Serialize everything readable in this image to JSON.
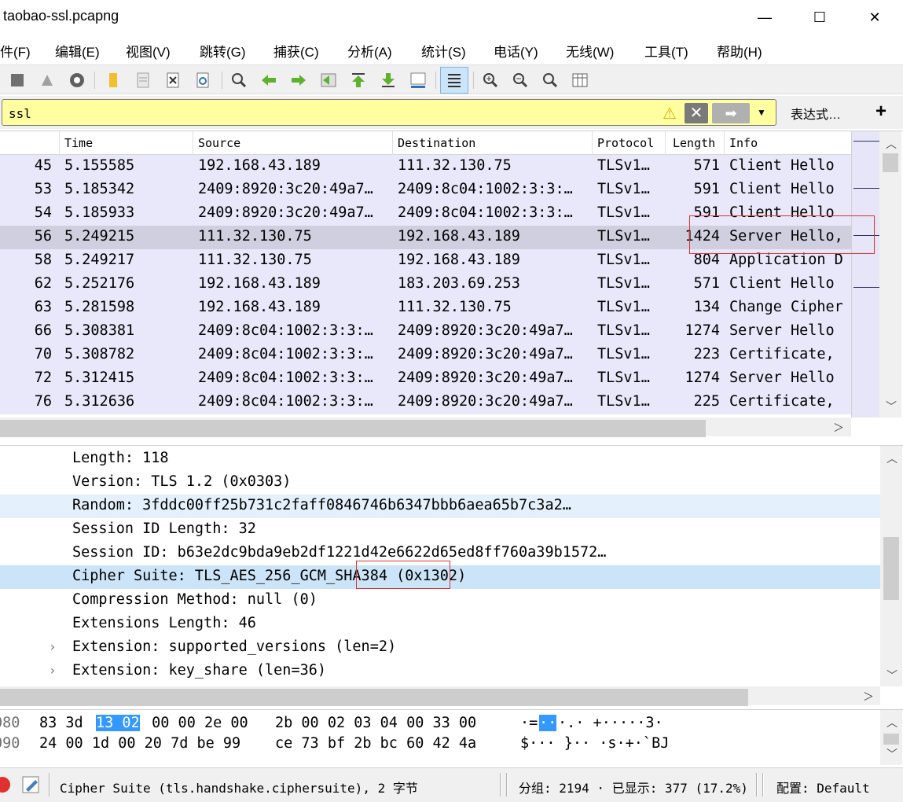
{
  "window": {
    "title": "taobao-ssl.pcapng",
    "minimize": "—",
    "maximize": "☐",
    "close": "✕"
  },
  "menu": [
    "件(F)",
    "编辑(E)",
    "视图(V)",
    "跳转(G)",
    "捕获(C)",
    "分析(A)",
    "统计(S)",
    "电话(Y)",
    "无线(W)",
    "工具(T)",
    "帮助(H)"
  ],
  "toolbar": {
    "icons": [
      "stop-capture-icon",
      "restart-capture-icon",
      "capture-options-icon",
      "open-file-icon",
      "save-file-icon",
      "close-file-icon",
      "reload-file-icon",
      "find-packet-icon",
      "go-back-icon",
      "go-forward-icon",
      "go-to-packet-icon",
      "go-first-icon",
      "go-last-icon",
      "autoscroll-icon",
      "colorize-icon",
      "zoom-in-icon",
      "zoom-out-icon",
      "zoom-normal-icon",
      "resize-columns-icon"
    ]
  },
  "filter": {
    "value": "ssl",
    "expression_label": "表达式…",
    "add_label": "+",
    "bg_color": "#ffffa0"
  },
  "packet_list": {
    "columns": [
      "Time",
      "Source",
      "Destination",
      "Protocol",
      "Length",
      "Info"
    ],
    "rows": [
      {
        "no": "45",
        "time": "5.155585",
        "src": "192.168.43.189",
        "dst": "111.32.130.75",
        "proto": "TLSv1…",
        "len": "571",
        "info": "Client Hello"
      },
      {
        "no": "53",
        "time": "5.185342",
        "src": "2409:8920:3c20:49a7…",
        "dst": "2409:8c04:1002:3:3:…",
        "proto": "TLSv1…",
        "len": "591",
        "info": "Client Hello"
      },
      {
        "no": "54",
        "time": "5.185933",
        "src": "2409:8920:3c20:49a7…",
        "dst": "2409:8c04:1002:3:3:…",
        "proto": "TLSv1…",
        "len": "591",
        "info": "Client Hello"
      },
      {
        "no": "56",
        "time": "5.249215",
        "src": "111.32.130.75",
        "dst": "192.168.43.189",
        "proto": "TLSv1…",
        "len": "1424",
        "info": "Server Hello,"
      },
      {
        "no": "58",
        "time": "5.249217",
        "src": "111.32.130.75",
        "dst": "192.168.43.189",
        "proto": "TLSv1…",
        "len": "804",
        "info": "Application D"
      },
      {
        "no": "62",
        "time": "5.252176",
        "src": "192.168.43.189",
        "dst": "183.203.69.253",
        "proto": "TLSv1…",
        "len": "571",
        "info": "Client Hello"
      },
      {
        "no": "63",
        "time": "5.281598",
        "src": "192.168.43.189",
        "dst": "111.32.130.75",
        "proto": "TLSv1…",
        "len": "134",
        "info": "Change Cipher"
      },
      {
        "no": "66",
        "time": "5.308381",
        "src": "2409:8c04:1002:3:3:…",
        "dst": "2409:8920:3c20:49a7…",
        "proto": "TLSv1…",
        "len": "1274",
        "info": "Server Hello"
      },
      {
        "no": "70",
        "time": "5.308782",
        "src": "2409:8c04:1002:3:3:…",
        "dst": "2409:8920:3c20:49a7…",
        "proto": "TLSv1…",
        "len": "223",
        "info": "Certificate,"
      },
      {
        "no": "72",
        "time": "5.312415",
        "src": "2409:8c04:1002:3:3:…",
        "dst": "2409:8920:3c20:49a7…",
        "proto": "TLSv1…",
        "len": "1274",
        "info": "Server Hello"
      },
      {
        "no": "76",
        "time": "5.312636",
        "src": "2409:8c04:1002:3:3:…",
        "dst": "2409:8920:3c20:49a7…",
        "proto": "TLSv1…",
        "len": "225",
        "info": "Certificate,"
      }
    ],
    "row_color": "#e8e8fa",
    "selected_color": "#cfcfe0"
  },
  "details": {
    "rows": [
      {
        "text": "Length: 118"
      },
      {
        "text": "Version: TLS 1.2 (0x0303)"
      },
      {
        "text": "Random: 3fddc00ff25b731c2faff0846746b6347bbb6aea65b7c3a2…"
      },
      {
        "text": "Session ID Length: 32"
      },
      {
        "text": "Session ID: b63e2dc9bda9eb2df1221d42e6622d65ed8ff760a39b1572…"
      },
      {
        "text": "Cipher Suite: TLS_AES_256_GCM_SHA384 (0x1302)"
      },
      {
        "text": "Compression Method: null (0)"
      },
      {
        "text": "Extensions Length: 46"
      },
      {
        "text": "Extension: supported_versions (len=2)"
      },
      {
        "text": "Extension: key_share (len=36)"
      }
    ],
    "selected_color": "#cce4f7"
  },
  "hex": {
    "rows": [
      {
        "offset": "080",
        "pre": "83 3d ",
        "sel": "13 02",
        "post": " 00 00 2e 00",
        "b2": "2b 00 02 03 04 00 33 00",
        "ascii_pre": "·=",
        "ascii_sel": "··",
        "ascii_post": "·.· +·····3·"
      },
      {
        "offset": "090",
        "pre": "24 00 1d 00 20 7d be 99",
        "sel": "",
        "post": "",
        "b2": "ce 73 bf 2b bc 60 42 4a",
        "ascii_pre": "$··· }·· ·s·+·`BJ",
        "ascii_sel": "",
        "ascii_post": ""
      }
    ]
  },
  "status": {
    "field_info": "Cipher Suite (tls.handshake.ciphersuite), 2 字节",
    "packets_info": "分组: 2194 · 已显示: 377 (17.2%)",
    "profile_info": "配置: Default"
  }
}
